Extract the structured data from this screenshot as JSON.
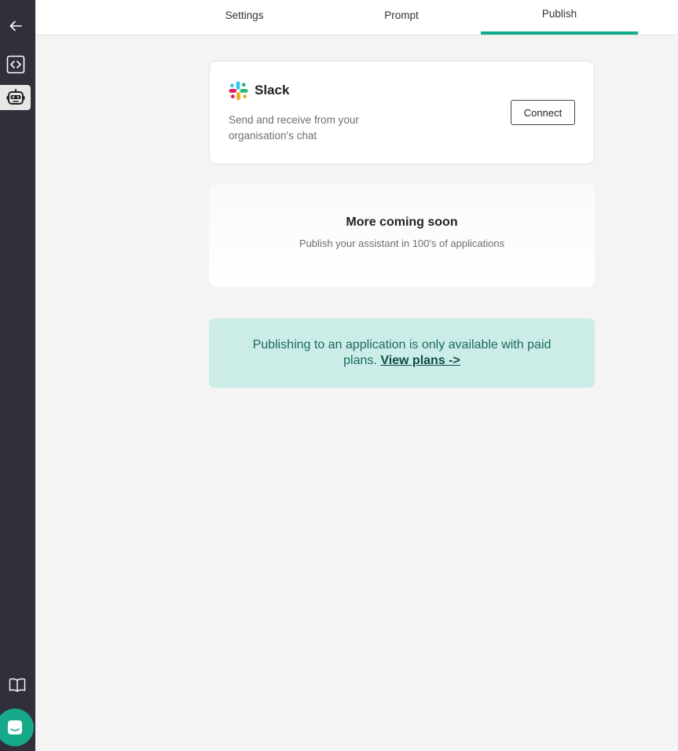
{
  "tabs": {
    "settings": "Settings",
    "prompt": "Prompt",
    "publish": "Publish",
    "active": "publish"
  },
  "slack": {
    "title": "Slack",
    "description": "Send and receive from your organisation's chat",
    "connect_label": "Connect"
  },
  "coming_soon": {
    "title": "More coming soon",
    "subtitle": "Publish your assistant in 100's of applications"
  },
  "notice": {
    "text": "Publishing to an application is only available with paid plans.",
    "link_label": "View plans ->"
  },
  "colors": {
    "accent": "#10ad8e",
    "sidebar": "#312f3a",
    "notice_bg": "#ccede7",
    "notice_text": "#1a6a62"
  },
  "icons": {
    "back": "arrow-left-icon",
    "code": "code-icon",
    "bot": "robot-icon",
    "docs": "book-icon",
    "chat": "chat-icon"
  }
}
